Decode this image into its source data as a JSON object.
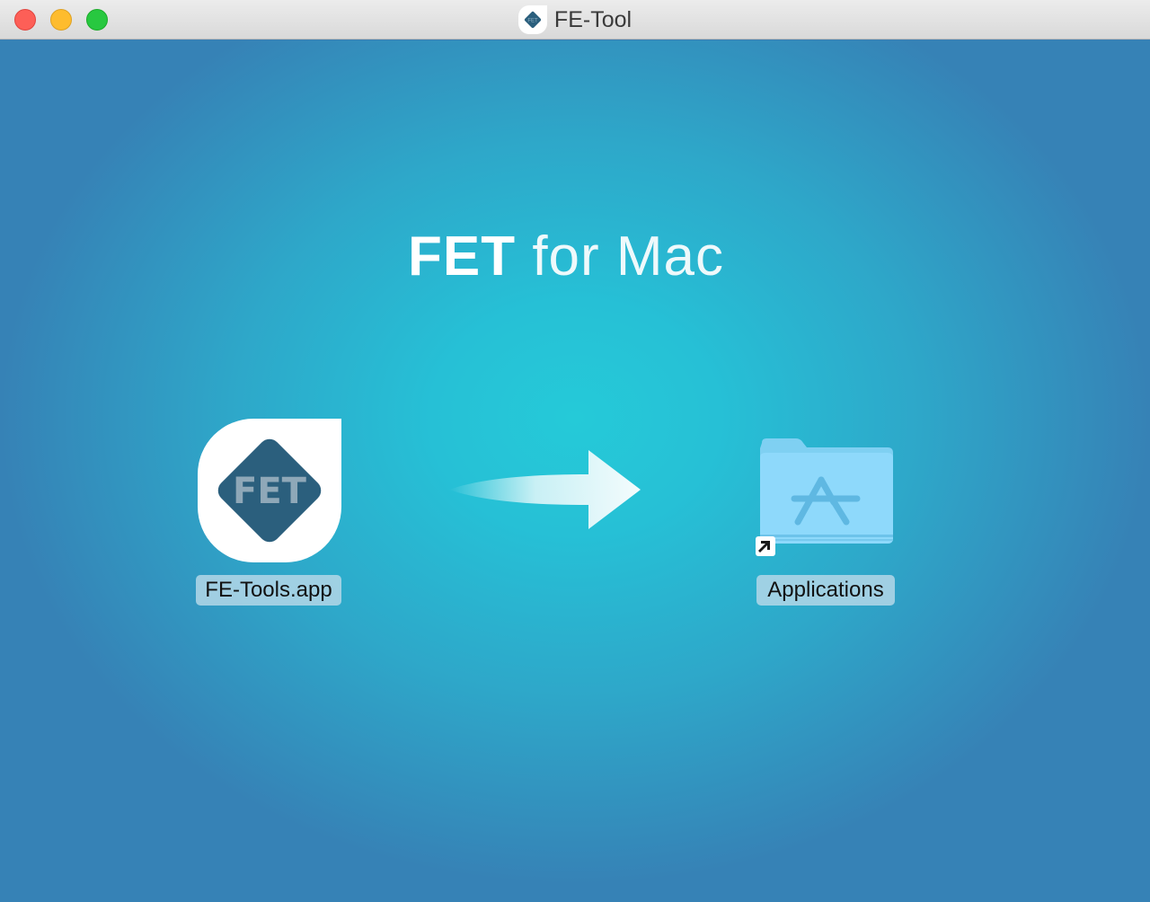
{
  "window": {
    "title": "FE-Tool",
    "title_icon": "fet-app-icon",
    "controls": [
      "close",
      "minimize",
      "zoom"
    ]
  },
  "installer": {
    "headline_bold": "FET",
    "headline_light": "for Mac",
    "app": {
      "icon_text": "FET",
      "label": "FE-Tools.app",
      "icon": "fet-app-icon"
    },
    "arrow": "drag-arrow-icon",
    "destination": {
      "label": "Applications",
      "icon": "applications-folder-icon",
      "alias_badge": "alias-arrow-icon"
    }
  },
  "colors": {
    "brand_diamond": "#2b5f7d",
    "background_center": "#25cad8",
    "background_edge": "#3682b6"
  }
}
